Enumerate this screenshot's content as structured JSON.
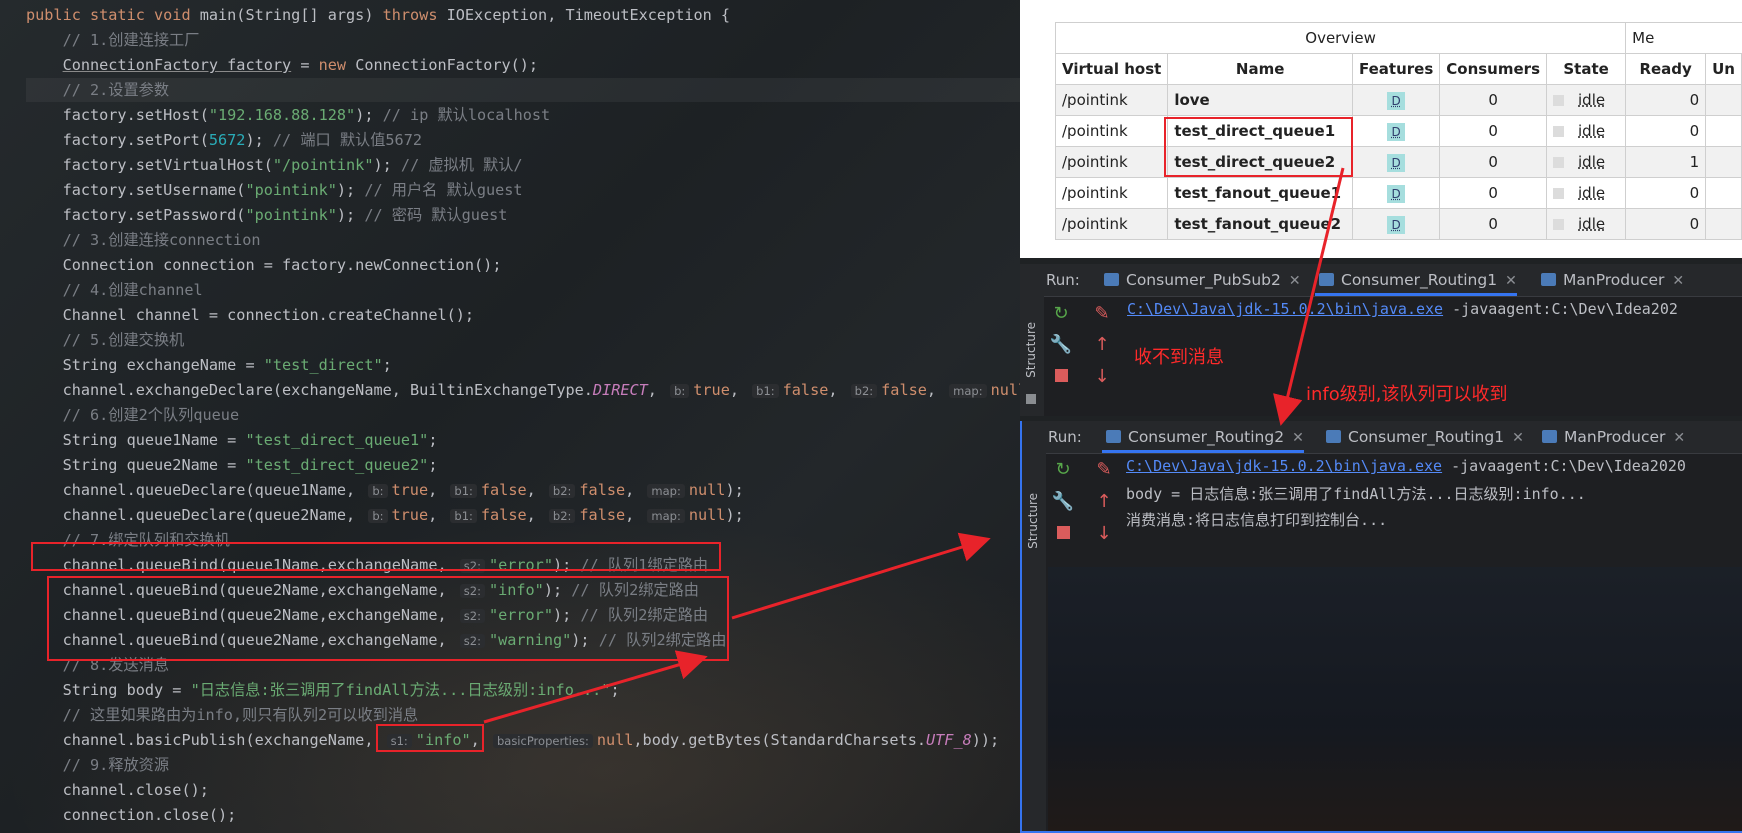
{
  "editor": {
    "lines": [
      [
        [
          "k",
          "public static void "
        ],
        [
          "m",
          "main(String[] args) "
        ],
        [
          "k",
          "throws "
        ],
        [
          "m",
          "IOException, TimeoutException {"
        ]
      ],
      [
        [
          "c",
          "    // 1.创建连接工厂"
        ]
      ],
      [
        [
          "m",
          "    "
        ],
        [
          "ul",
          "ConnectionFactory factory"
        ],
        [
          "m",
          " = "
        ],
        [
          "k",
          "new "
        ],
        [
          "m",
          "ConnectionFactory();"
        ]
      ],
      [
        [
          "c",
          "    // 2.设置参数"
        ]
      ],
      [
        [
          "m",
          "    factory.setHost("
        ],
        [
          "s",
          "\"192.168.88.128\""
        ],
        [
          "m",
          "); "
        ],
        [
          "c",
          "// ip 默认localhost"
        ]
      ],
      [
        [
          "m",
          "    factory.setPort("
        ],
        [
          "n",
          "5672"
        ],
        [
          "m",
          "); "
        ],
        [
          "c",
          "// 端口 默认值5672"
        ]
      ],
      [
        [
          "m",
          "    factory.setVirtualHost("
        ],
        [
          "s",
          "\"/pointink\""
        ],
        [
          "m",
          "); "
        ],
        [
          "c",
          "// 虚拟机 默认/"
        ]
      ],
      [
        [
          "m",
          "    factory.setUsername("
        ],
        [
          "s",
          "\"pointink\""
        ],
        [
          "m",
          "); "
        ],
        [
          "c",
          "// 用户名 默认guest"
        ]
      ],
      [
        [
          "m",
          "    factory.setPassword("
        ],
        [
          "s",
          "\"pointink\""
        ],
        [
          "m",
          "); "
        ],
        [
          "c",
          "// 密码 默认guest"
        ]
      ],
      [
        [
          "c",
          "    // 3.创建连接connection"
        ]
      ],
      [
        [
          "m",
          "    Connection connection = factory.newConnection();"
        ]
      ],
      [
        [
          "c",
          "    // 4.创建channel"
        ]
      ],
      [
        [
          "m",
          "    Channel channel = connection.createChannel();"
        ]
      ],
      [
        [
          "c",
          "    // 5.创建交换机"
        ]
      ],
      [
        [
          "m",
          "    String exchangeName = "
        ],
        [
          "s",
          "\"test_direct\""
        ],
        [
          "m",
          ";"
        ]
      ],
      [
        [
          "m",
          "    channel.exchangeDeclare(exchangeName, BuiltinExchangeType."
        ],
        [
          "cst",
          "DIRECT"
        ],
        [
          "m",
          ", "
        ],
        [
          "hint",
          "b:"
        ],
        [
          "k",
          "true"
        ],
        [
          "m",
          ", "
        ],
        [
          "hint",
          "b1:"
        ],
        [
          "k",
          "false"
        ],
        [
          "m",
          ", "
        ],
        [
          "hint",
          "b2:"
        ],
        [
          "k",
          "false"
        ],
        [
          "m",
          ", "
        ],
        [
          "hint",
          "map:"
        ],
        [
          "k",
          "null"
        ],
        [
          "m",
          ");"
        ]
      ],
      [
        [
          "c",
          "    // 6.创建2个队列queue"
        ]
      ],
      [
        [
          "m",
          "    String queue1Name = "
        ],
        [
          "s",
          "\"test_direct_queue1\""
        ],
        [
          "m",
          ";"
        ]
      ],
      [
        [
          "m",
          "    String queue2Name = "
        ],
        [
          "s",
          "\"test_direct_queue2\""
        ],
        [
          "m",
          ";"
        ]
      ],
      [
        [
          "m",
          "    channel.queueDeclare(queue1Name, "
        ],
        [
          "hint",
          "b:"
        ],
        [
          "k",
          "true"
        ],
        [
          "m",
          ", "
        ],
        [
          "hint",
          "b1:"
        ],
        [
          "k",
          "false"
        ],
        [
          "m",
          ", "
        ],
        [
          "hint",
          "b2:"
        ],
        [
          "k",
          "false"
        ],
        [
          "m",
          ", "
        ],
        [
          "hint",
          "map:"
        ],
        [
          "k",
          "null"
        ],
        [
          "m",
          ");"
        ]
      ],
      [
        [
          "m",
          "    channel.queueDeclare(queue2Name, "
        ],
        [
          "hint",
          "b:"
        ],
        [
          "k",
          "true"
        ],
        [
          "m",
          ", "
        ],
        [
          "hint",
          "b1:"
        ],
        [
          "k",
          "false"
        ],
        [
          "m",
          ", "
        ],
        [
          "hint",
          "b2:"
        ],
        [
          "k",
          "false"
        ],
        [
          "m",
          ", "
        ],
        [
          "hint",
          "map:"
        ],
        [
          "k",
          "null"
        ],
        [
          "m",
          ");"
        ]
      ],
      [
        [
          "c",
          "    // 7.绑定队列和交换机"
        ]
      ],
      [
        [
          "m",
          "    channel.queueBind(queue1Name,exchangeName, "
        ],
        [
          "hint",
          "s2:"
        ],
        [
          "s",
          "\"error\""
        ],
        [
          "m",
          "); "
        ],
        [
          "c",
          "// 队列1绑定路由"
        ]
      ],
      [
        [
          "m",
          "    channel.queueBind(queue2Name,exchangeName, "
        ],
        [
          "hint",
          "s2:"
        ],
        [
          "s",
          "\"info\""
        ],
        [
          "m",
          "); "
        ],
        [
          "c",
          "// 队列2绑定路由"
        ]
      ],
      [
        [
          "m",
          "    channel.queueBind(queue2Name,exchangeName, "
        ],
        [
          "hint",
          "s2:"
        ],
        [
          "s",
          "\"error\""
        ],
        [
          "m",
          "); "
        ],
        [
          "c",
          "// 队列2绑定路由"
        ]
      ],
      [
        [
          "m",
          "    channel.queueBind(queue2Name,exchangeName, "
        ],
        [
          "hint",
          "s2:"
        ],
        [
          "s",
          "\"warning\""
        ],
        [
          "m",
          "); "
        ],
        [
          "c",
          "// 队列2绑定路由"
        ]
      ],
      [
        [
          "c",
          "    // 8.发送消息"
        ]
      ],
      [
        [
          "m",
          "    String body = "
        ],
        [
          "s",
          "\"日志信息:张三调用了findAll方法...日志级别:info...\""
        ],
        [
          "m",
          ";"
        ]
      ],
      [
        [
          "c",
          "    // 这里如果路由为info,则只有队列2可以收到消息"
        ]
      ],
      [
        [
          "m",
          "    channel.basicPublish(exchangeName, "
        ],
        [
          "hint",
          "s1:"
        ],
        [
          "s",
          "\"info\""
        ],
        [
          "m",
          ", "
        ],
        [
          "hint",
          "basicProperties:"
        ],
        [
          "k",
          "null"
        ],
        [
          "m",
          ",body.getBytes(StandardCharsets."
        ],
        [
          "cst",
          "UTF_8"
        ],
        [
          "m",
          "));"
        ]
      ],
      [
        [
          "c",
          "    // 9.释放资源"
        ]
      ],
      [
        [
          "m",
          "    channel.close();"
        ]
      ],
      [
        [
          "m",
          "    connection.close();"
        ]
      ]
    ]
  },
  "queues": {
    "group_header": "Overview",
    "group_header2": "Me",
    "columns": [
      "Virtual host",
      "Name",
      "Features",
      "Consumers",
      "State",
      "Ready",
      "Un"
    ],
    "rows": [
      {
        "vhost": "/pointink",
        "name": "love",
        "feature": "D",
        "consumers": "0",
        "state": "idle",
        "ready": "0"
      },
      {
        "vhost": "/pointink",
        "name": "test_direct_queue1",
        "feature": "D",
        "consumers": "0",
        "state": "idle",
        "ready": "0"
      },
      {
        "vhost": "/pointink",
        "name": "test_direct_queue2",
        "feature": "D",
        "consumers": "0",
        "state": "idle",
        "ready": "1"
      },
      {
        "vhost": "/pointink",
        "name": "test_fanout_queue1",
        "feature": "D",
        "consumers": "0",
        "state": "idle",
        "ready": "0"
      },
      {
        "vhost": "/pointink",
        "name": "test_fanout_queue2",
        "feature": "D",
        "consumers": "0",
        "state": "idle",
        "ready": "0"
      }
    ]
  },
  "run1": {
    "label": "Run:",
    "tabs": [
      "Consumer_PubSub2",
      "Consumer_Routing1",
      "ManProducer"
    ],
    "side_label": "Structure",
    "cmd_link": "C:\\Dev\\Java\\jdk-15.0.2\\bin\\java.exe",
    "cmd_rest": " -javaagent:C:\\Dev\\Idea202",
    "annotation": "收不到消息"
  },
  "run2": {
    "label": "Run:",
    "tabs": [
      "Consumer_Routing2",
      "Consumer_Routing1",
      "ManProducer"
    ],
    "side_label": "Structure",
    "cmd_link": "C:\\Dev\\Java\\jdk-15.0.2\\bin\\java.exe",
    "cmd_rest": " -javaagent:C:\\Dev\\Idea2020",
    "out1": "body = 日志信息:张三调用了findAll方法...日志级别:info...",
    "out2": "消费消息:将日志信息打印到控制台..."
  },
  "annotation_between": "info级别,该队列可以收到",
  "colors": {
    "annotation": "#e8232a",
    "link": "#548af7",
    "keyword": "#cf8e6d",
    "string": "#6aab73"
  }
}
